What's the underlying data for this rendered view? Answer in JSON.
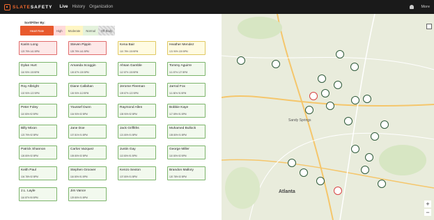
{
  "app": {
    "logo_word_1": "SLATE",
    "logo_word_2": "SAFETY",
    "nav": [
      "Live",
      "History",
      "Organization"
    ],
    "user_menu": "More"
  },
  "filter": {
    "title": "Sort/Filter By:",
    "sort_button": "Heart Rate",
    "chips": [
      "High",
      "Moderate",
      "Normal",
      "Off-Body"
    ]
  },
  "workers": [
    {
      "name": "Karim Long",
      "status": "high",
      "sub": "123  79%  141 BPM"
    },
    {
      "name": "Steven Pippin",
      "status": "high",
      "sub": "125  79%  141 BPM"
    },
    {
      "name": "Kena Bair",
      "status": "mod",
      "sub": "110  78%  130 BPM"
    },
    {
      "name": "Heather Mendez",
      "status": "mod",
      "sub": "121  90%  130 BPM"
    },
    {
      "name": "Dylan Hurt",
      "status": "normal",
      "sub": "116  90%  130 BPM"
    },
    {
      "name": "Amanda Scoggin",
      "status": "normal",
      "sub": "126  87%  130 BPM"
    },
    {
      "name": "Ahsan Gamble",
      "status": "normal",
      "sub": "112  87%  130 BPM"
    },
    {
      "name": "Tommy Aguirre",
      "status": "normal",
      "sub": "111  87%  127 BPM"
    },
    {
      "name": "Roy Albright",
      "status": "normal",
      "sub": "102  90%  122 BPM"
    },
    {
      "name": "Diane Callahan",
      "status": "normal",
      "sub": "126  90%  112 BPM"
    },
    {
      "name": "Jerome Fleeman",
      "status": "normal",
      "sub": "109  87%  122 BPM"
    },
    {
      "name": "Jarrod Fox",
      "status": "normal",
      "sub": "111  80%  91 BPM"
    },
    {
      "name": "Peter Foley",
      "status": "normal",
      "sub": "110  80%  92 BPM"
    },
    {
      "name": "Youssef Dunn",
      "status": "normal",
      "sub": "104  90%  92 BPM"
    },
    {
      "name": "Raymond Allen",
      "status": "normal",
      "sub": "105  90%  92 BPM"
    },
    {
      "name": "Bobbie Kaye",
      "status": "normal",
      "sub": "117  89%  91 BPM"
    },
    {
      "name": "Billy Mixon",
      "status": "normal",
      "sub": "123  79%  92 BPM"
    },
    {
      "name": "Jane Doe",
      "status": "normal",
      "sub": "107  81%  91 BPM"
    },
    {
      "name": "Jack Griffiths",
      "status": "normal",
      "sub": "121  80%  91 BPM"
    },
    {
      "name": "Muhamed Bullock",
      "status": "normal",
      "sub": "105  80%  91 BPM"
    },
    {
      "name": "Patrick Shannon",
      "status": "normal",
      "sub": "126  80%  92 BPM"
    },
    {
      "name": "Carlos Vazquez",
      "status": "normal",
      "sub": "105  80%  92 BPM"
    },
    {
      "name": "Justin Gay",
      "status": "normal",
      "sub": "113  80%  91 BPM"
    },
    {
      "name": "George Miller",
      "status": "normal",
      "sub": "110  80%  92 BPM"
    },
    {
      "name": "Keith Paul",
      "status": "normal",
      "sub": "104  78%  92 BPM"
    },
    {
      "name": "Stephen Groover",
      "status": "normal",
      "sub": "116  80%  91 BPM"
    },
    {
      "name": "Kenzo Sexton",
      "status": "normal",
      "sub": "107  80%  91 BPM"
    },
    {
      "name": "Brandon Mallory",
      "status": "normal",
      "sub": "120  78%  92 BPM"
    },
    {
      "name": "J.L. Layle",
      "status": "normal",
      "sub": "116  87%  90 BPM"
    },
    {
      "name": "Jim Vance",
      "status": "normal",
      "sub": "129  80%  91 BPM"
    }
  ],
  "map": {
    "city_label": "Atlanta",
    "area_label": "Sandy Springs",
    "zoom_in": "+",
    "zoom_out": "−"
  }
}
